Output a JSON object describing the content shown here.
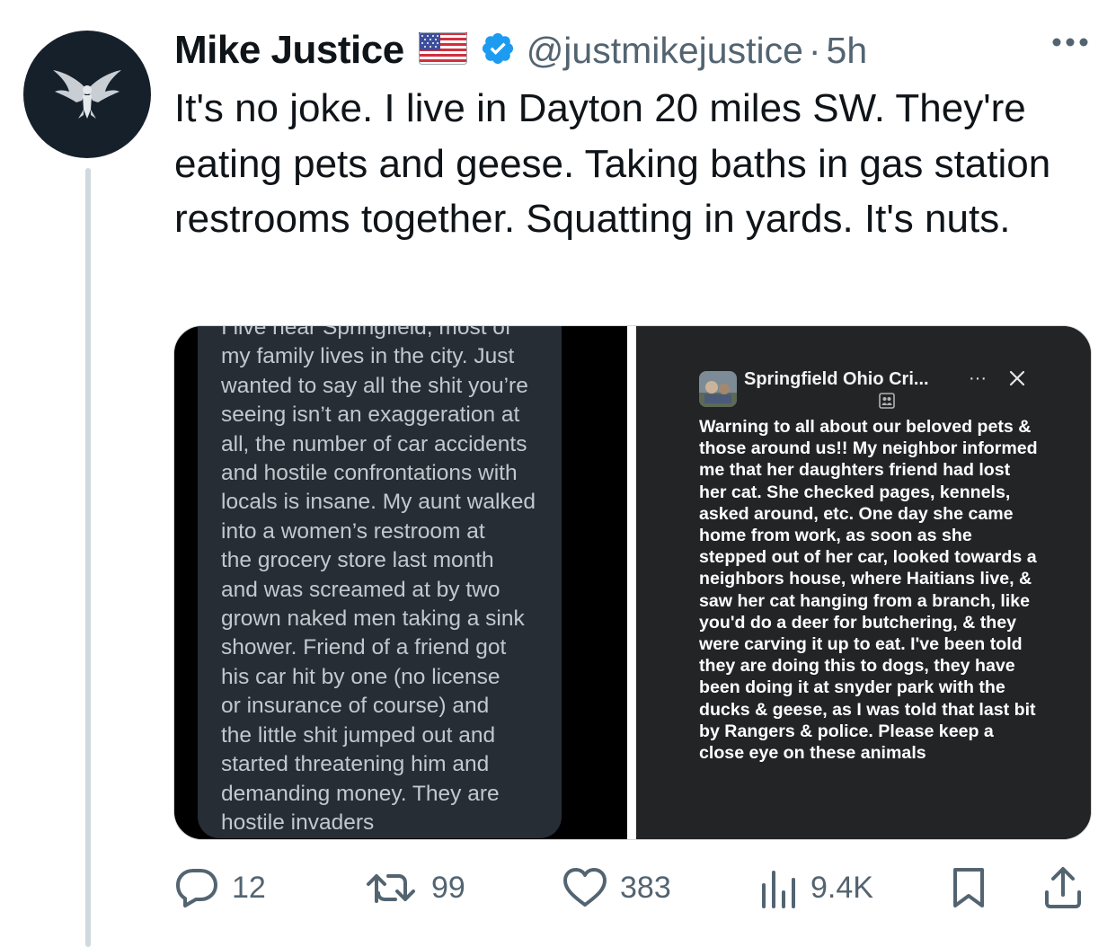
{
  "author": {
    "name": "Mike Justice",
    "flag_icon": "us-flag-icon",
    "verified_icon": "verified-badge-icon",
    "handle": "@justmikejustice",
    "separator": "·",
    "time": "5h"
  },
  "tweet": {
    "text": "It's no joke. I live in Dayton 20 miles SW. They're eating pets and geese. Taking baths in gas station restrooms together. Squatting in yards. It's nuts."
  },
  "media": {
    "left_screenshot": {
      "text": "I live near Springfield, most of\nmy family lives in the city. Just\nwanted to say all the shit you’re\nseeing isn’t an exaggeration at\nall, the number of car accidents\nand hostile confrontations with\nlocals is insane. My aunt walked\ninto a women’s restroom at\nthe grocery store last month\nand was screamed at by two\ngrown naked men taking a sink\nshower. Friend of a friend got\nhis car hit by one (no license\nor insurance of course) and\nthe little shit jumped out and\nstarted threatening him and\ndemanding money. They are\nhostile invaders"
    },
    "right_screenshot": {
      "group_title": "Springfield Ohio Cri...",
      "more_label": "···",
      "post_text": "Warning to all about our beloved pets & those around us!! My neighbor informed me that her daughters friend had lost her cat. She checked pages, kennels, asked around, etc. One day she came home from work, as soon as she stepped out of her car, looked towards a neighbors house, where Haitians live, & saw her cat hanging from a branch, like you'd do a deer for butchering, & they were carving it up to eat. I've been told they are doing this to dogs, they have been doing it at snyder park with the ducks & geese, as I was told that last bit by Rangers & police. Please keep a close eye on these animals"
    }
  },
  "actions": {
    "replies": "12",
    "reposts": "99",
    "likes": "383",
    "views": "9.4K"
  },
  "colors": {
    "text": "#0f1419",
    "secondary": "#536471",
    "verified": "#1d9bf0",
    "avatar_bg": "#15202b"
  }
}
